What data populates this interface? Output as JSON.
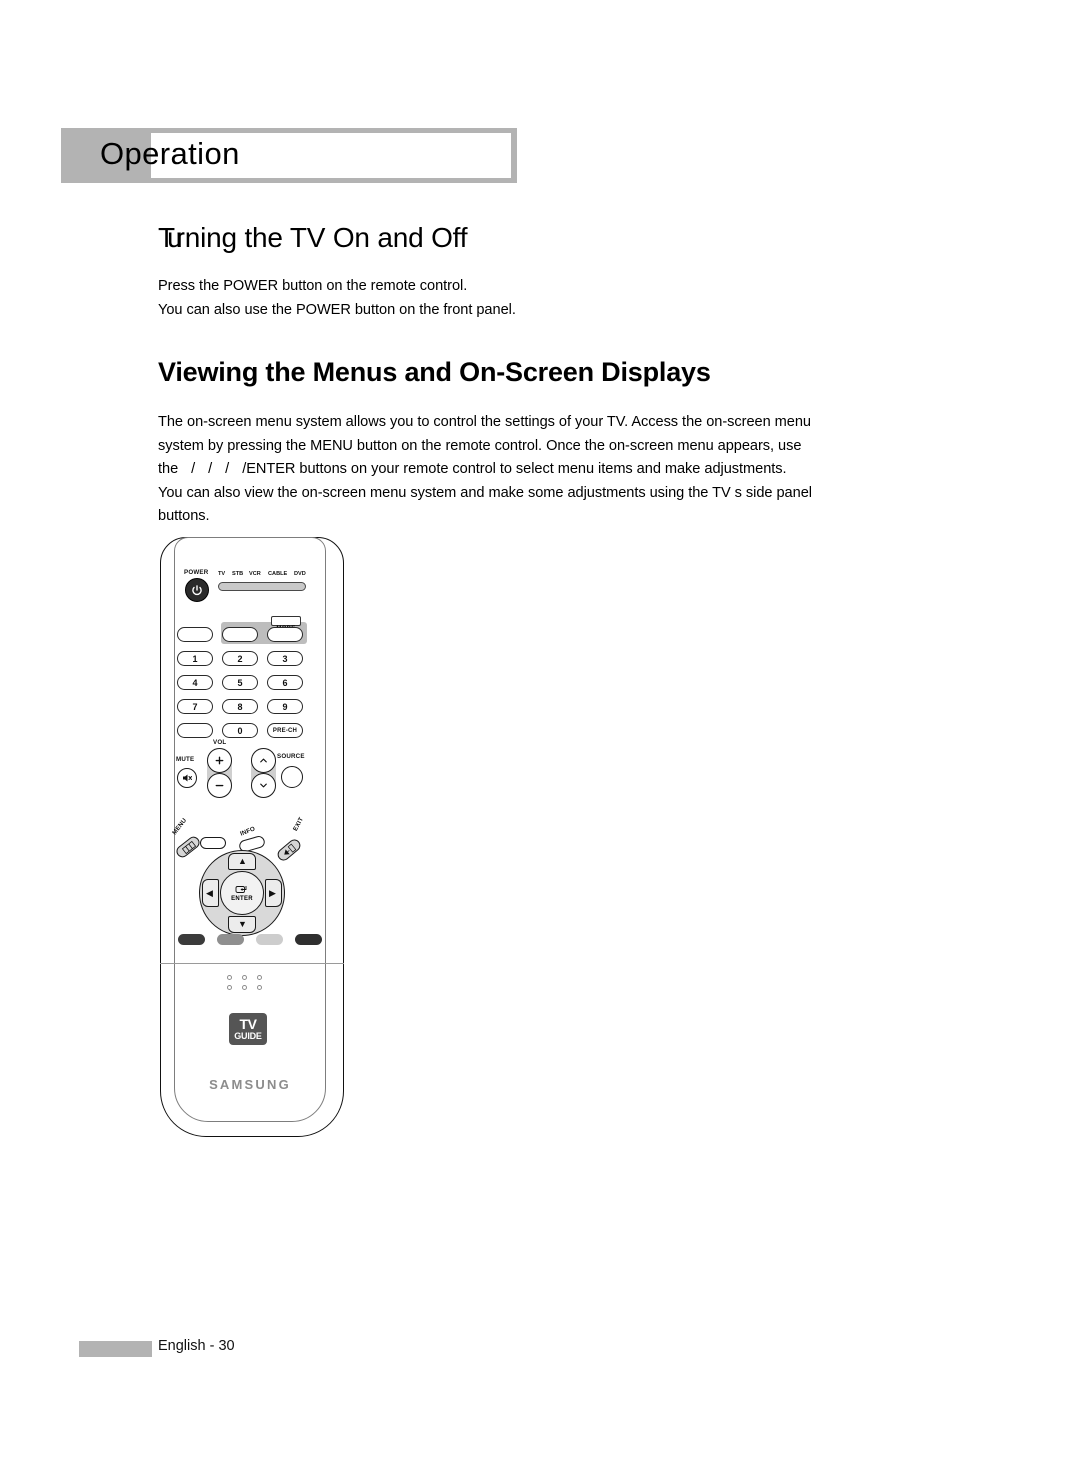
{
  "chapter": {
    "label": "Operation"
  },
  "sections": [
    {
      "heading_prefix": "Tu",
      "heading_rest": "rning the TV On and Off",
      "heading_full": "Turning the TV On and Off",
      "body_lines": [
        "Press the POWER button on the remote control.",
        "You can also use the POWER button on the front panel."
      ]
    },
    {
      "heading_full": "Viewing the Menus and On-Screen Displays",
      "body_parts": {
        "l1": "The on-screen menu system allows you to control the settings of your TV. Access the on-screen menu",
        "l2": "system by pressing the MENU button on the remote control. Once the on-screen menu appears, use",
        "l3a": "the",
        "l3b": "/",
        "l3c": "/",
        "l3d": "/",
        "l3e": "/ENTER buttons on your remote control to select menu items and make adjustments.",
        "l4": "You can also view the on-screen menu system and make some adjustments using the TV s side panel",
        "l5": "buttons."
      }
    }
  ],
  "remote": {
    "power_label": "POWER",
    "mode_indicators": [
      "TV",
      "STB",
      "VCR",
      "CABLE",
      "DVD"
    ],
    "mode_button": "MODE",
    "keypad": [
      {
        "label": ""
      },
      {
        "label": ""
      },
      {
        "label": ""
      },
      {
        "label": "1"
      },
      {
        "label": "2"
      },
      {
        "label": "3"
      },
      {
        "label": "4"
      },
      {
        "label": "5"
      },
      {
        "label": "6"
      },
      {
        "label": "7"
      },
      {
        "label": "8"
      },
      {
        "label": "9"
      },
      {
        "label": ""
      },
      {
        "label": "0"
      },
      {
        "label": "PRE-CH"
      }
    ],
    "keypad_rows": [
      [
        "",
        "",
        "MODE"
      ],
      [
        "1",
        "2",
        "3"
      ],
      [
        "4",
        "5",
        "6"
      ],
      [
        "7",
        "8",
        "9"
      ],
      [
        "",
        "0",
        "PRE-CH"
      ]
    ],
    "mute_label": "MUTE",
    "vol_label": "VOL",
    "vol_plus": "+",
    "vol_minus": "−",
    "ch_up": "∧",
    "ch_down": "∨",
    "source_label": "SOURCE",
    "menu_label": "MENU",
    "info_label": "INFO",
    "exit_label": "EXIT",
    "enter_label": "ENTER",
    "arrow_up": "▲",
    "arrow_down": "▼",
    "arrow_left": "◀",
    "arrow_right": "▶",
    "color_buttons": [
      "#3b3b3b",
      "#8f8f8f",
      "#cdcdcd",
      "#2f2f2f"
    ],
    "tvguide": {
      "top": "TV",
      "bottom": "GUIDE"
    },
    "brand": "SAMSUNG"
  },
  "footer": {
    "text": "English - 30"
  },
  "colors": {
    "header_gray": "#b3b3b3",
    "page_bg": "#ffffff",
    "ink": "#000000",
    "brand_gray": "#8c8c8c"
  }
}
